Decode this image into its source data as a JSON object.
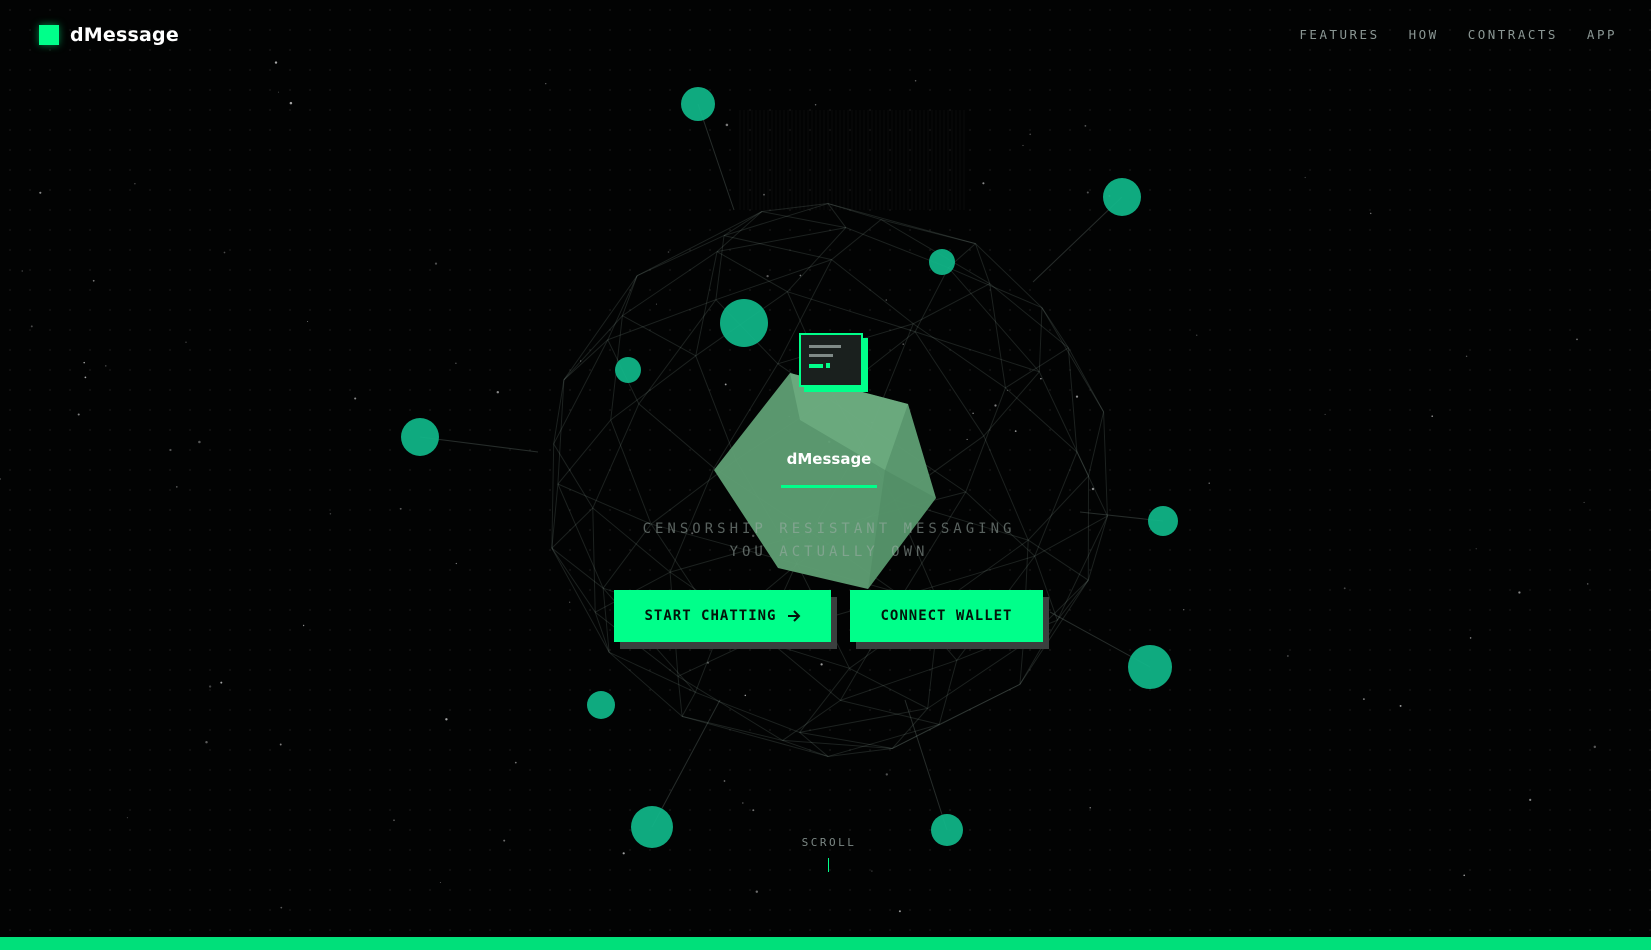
{
  "brand": {
    "name": "dMessage",
    "accent_color": "#00ff8a",
    "background_color": "#020303"
  },
  "nav": {
    "links": [
      "FEATURES",
      "HOW",
      "CONTRACTS",
      "APP"
    ]
  },
  "hero": {
    "core_label": "dMessage",
    "tagline_line1": "CENSORSHIP RESISTANT MESSAGING",
    "tagline_line2": "YOU ACTUALLY OWN",
    "card_icon": "message-card-icon"
  },
  "buttons": {
    "start_chatting": "START CHATTING",
    "start_arrow_icon": "arrow-right-icon",
    "connect_wallet": "CONNECT WALLET"
  },
  "scroll": {
    "label": "SCROLL"
  },
  "network": {
    "node_color": "#10b98a",
    "node_count": 15
  }
}
